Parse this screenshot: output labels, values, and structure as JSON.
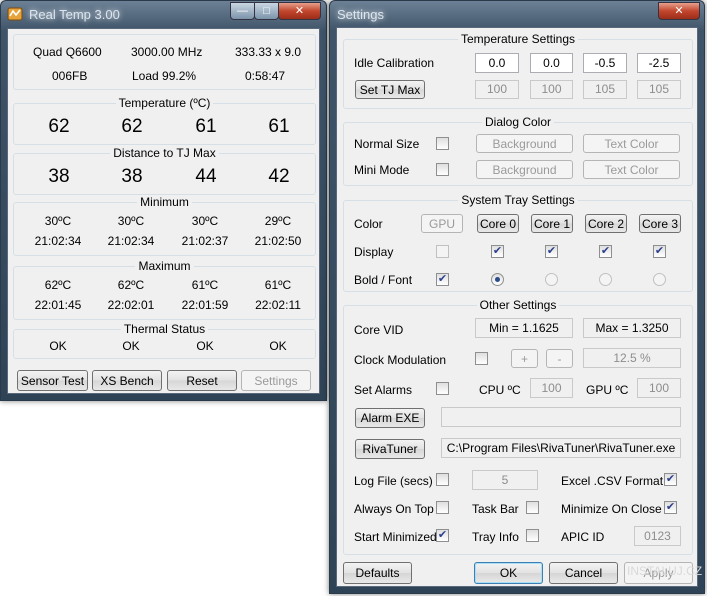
{
  "main": {
    "title": "Real Temp 3.00",
    "info": {
      "cpu": "Quad Q6600",
      "mhz": "3000.00 MHz",
      "fsb": "333.33 x 9.0",
      "stepping": "006FB",
      "load": "Load  99.2%",
      "uptime": "0:58:47"
    },
    "temperature": {
      "title": "Temperature (ºC)",
      "values": [
        "62",
        "62",
        "61",
        "61"
      ]
    },
    "distance": {
      "title": "Distance to TJ Max",
      "values": [
        "38",
        "38",
        "44",
        "42"
      ]
    },
    "minimum": {
      "title": "Minimum",
      "temps": [
        "30ºC",
        "30ºC",
        "30ºC",
        "29ºC"
      ],
      "times": [
        "21:02:34",
        "21:02:34",
        "21:02:37",
        "21:02:50"
      ]
    },
    "maximum": {
      "title": "Maximum",
      "temps": [
        "62ºC",
        "62ºC",
        "61ºC",
        "61ºC"
      ],
      "times": [
        "22:01:45",
        "22:02:01",
        "22:01:59",
        "22:02:11"
      ]
    },
    "thermal": {
      "title": "Thermal Status",
      "values": [
        "OK",
        "OK",
        "OK",
        "OK"
      ]
    },
    "buttons": {
      "sensor": "Sensor Test",
      "xs": "XS Bench",
      "reset": "Reset",
      "settings": "Settings"
    }
  },
  "settings": {
    "title": "Settings",
    "temp_settings": {
      "title": "Temperature Settings",
      "idle_label": "Idle Calibration",
      "idle": [
        "0.0",
        "0.0",
        "-0.5",
        "-2.5"
      ],
      "tj_button": "Set TJ Max",
      "tj": [
        "100",
        "100",
        "105",
        "105"
      ]
    },
    "dialog_color": {
      "title": "Dialog Color",
      "normal": "Normal Size",
      "mini": "Mini Mode",
      "background": "Background",
      "text_color": "Text Color"
    },
    "tray": {
      "title": "System Tray Settings",
      "color": "Color",
      "display": "Display",
      "bold": "Bold / Font",
      "gpu": "GPU",
      "cores": [
        "Core 0",
        "Core 1",
        "Core 2",
        "Core 3"
      ]
    },
    "other": {
      "title": "Other Settings",
      "vid": "Core VID",
      "vid_min": "Min = 1.1625",
      "vid_max": "Max = 1.3250",
      "clock": "Clock Modulation",
      "plus": "+",
      "minus": "-",
      "clock_val": "12.5 %",
      "alarms": "Set Alarms",
      "cpu": "CPU ºC",
      "cpu_val": "100",
      "gpu": "GPU ºC",
      "gpu_val": "100",
      "alarm_exe": "Alarm EXE",
      "alarm_path": "",
      "rivatuner": "RivaTuner",
      "rivatuner_path": "C:\\Program Files\\RivaTuner\\RivaTuner.exe",
      "logfile": "Log File (secs)",
      "logfile_val": "5",
      "excel": "Excel .CSV Format",
      "always_top": "Always On Top",
      "taskbar": "Task Bar",
      "minimize_close": "Minimize On Close",
      "start_min": "Start Minimized",
      "tray_info": "Tray Info",
      "apic": "APIC ID",
      "apic_val": "0123"
    },
    "buttons": {
      "defaults": "Defaults",
      "ok": "OK",
      "cancel": "Cancel",
      "apply": "Apply"
    }
  },
  "watermark": "INSTALUJ.CZ"
}
